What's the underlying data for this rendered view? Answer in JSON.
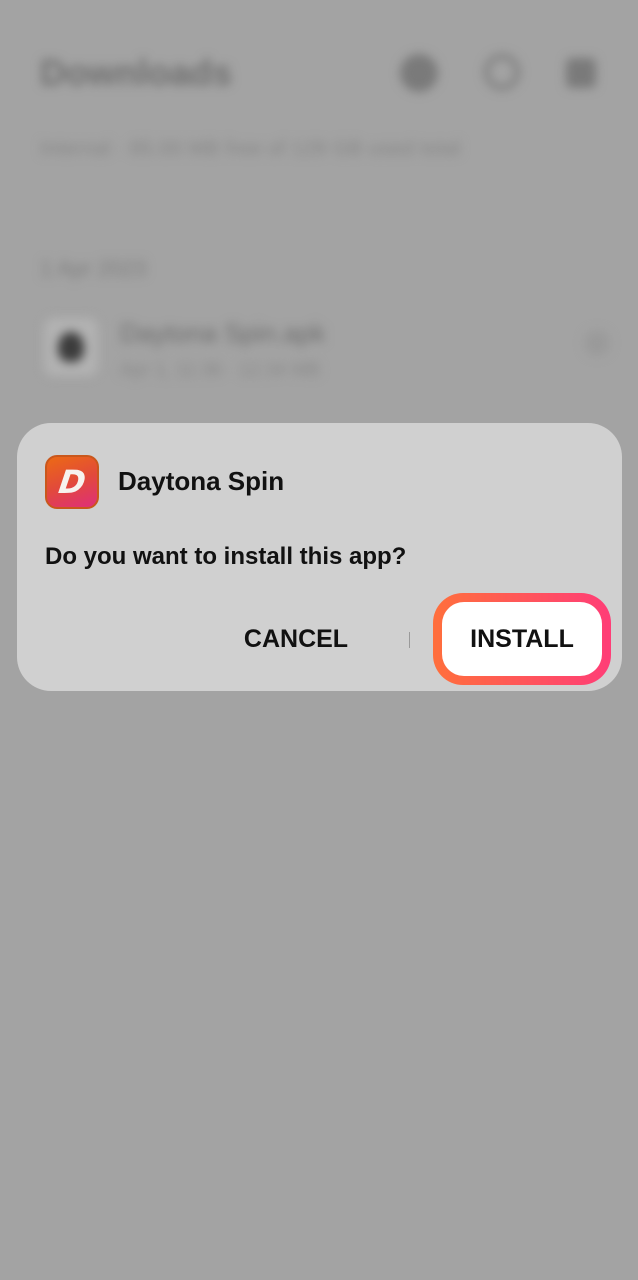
{
  "background": {
    "title": "Downloads",
    "subtitle": "Internal · 85.00 MB free of 128 GB used total",
    "section": "1 Apr 2023",
    "file_name": "Daytona Spin.apk",
    "file_meta": "Apr 1, 11:36 · 12.34 MB",
    "icons": [
      "gear-icon",
      "search-icon",
      "more-icon",
      "android-icon",
      "chevron-icon"
    ]
  },
  "dialog": {
    "app_icon_letter": "D",
    "app_name": "Daytona Spin",
    "question": "Do you want to install this app?",
    "cancel_label": "CANCEL",
    "install_label": "INSTALL",
    "highlight_colors": [
      "#ff6f3c",
      "#ff3d77"
    ]
  }
}
